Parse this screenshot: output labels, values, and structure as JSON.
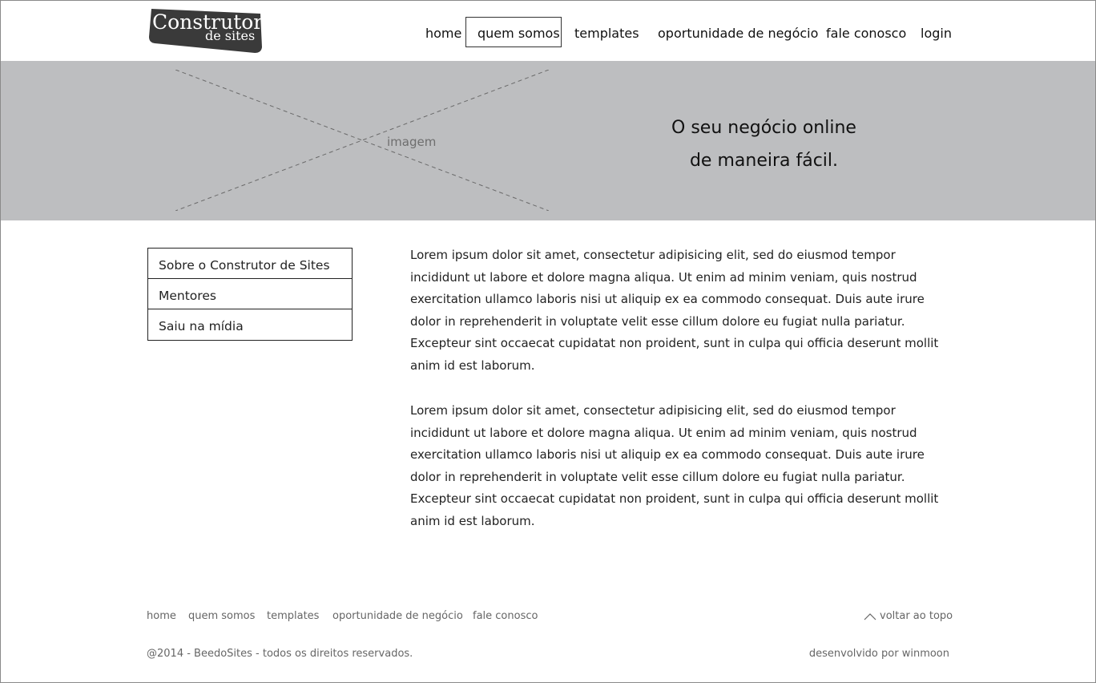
{
  "header": {
    "logo": {
      "line1": "Construtor",
      "line2": "de sites"
    },
    "nav": [
      {
        "label": "home"
      },
      {
        "label": "quem somos",
        "active": true
      },
      {
        "label": "templates"
      },
      {
        "label": "oportunidade de negócio"
      },
      {
        "label": "fale conosco"
      },
      {
        "label": "login"
      }
    ]
  },
  "hero": {
    "image_placeholder": "imagem",
    "tagline_line1": "O seu negócio online",
    "tagline_line2": "de maneira fácil.",
    "background_color": "#bdbec0"
  },
  "sidebar": {
    "items": [
      {
        "label": "Sobre o Construtor de Sites"
      },
      {
        "label": "Mentores"
      },
      {
        "label": "Saiu na mídia"
      }
    ]
  },
  "content": {
    "paragraphs": [
      "Lorem ipsum dolor sit amet, consectetur adipisicing elit, sed do eiusmod tempor incididunt ut labore et dolore magna aliqua. Ut enim ad minim veniam, quis nostrud exercitation ullamco laboris nisi ut aliquip ex ea commodo consequat. Duis aute irure dolor in reprehenderit in voluptate velit esse cillum dolore eu fugiat nulla pariatur. Excepteur sint occaecat cupidatat non proident, sunt in culpa qui officia deserunt mollit anim id est laborum.",
      "Lorem ipsum dolor sit amet, consectetur adipisicing elit, sed do eiusmod tempor incididunt ut labore et dolore magna aliqua. Ut enim ad minim veniam, quis nostrud exercitation ullamco laboris nisi ut aliquip ex ea commodo consequat. Duis aute irure dolor in reprehenderit in voluptate velit esse cillum dolore eu fugiat nulla pariatur. Excepteur sint occaecat cupidatat non proident, sunt in culpa qui officia deserunt mollit anim id est laborum."
    ]
  },
  "footer": {
    "nav": [
      {
        "label": "home"
      },
      {
        "label": "quem somos"
      },
      {
        "label": "templates"
      },
      {
        "label": "oportunidade de negócio"
      },
      {
        "label": "fale conosco"
      }
    ],
    "back_to_top": "voltar ao topo",
    "back_to_top_icon": "chevron-up-icon",
    "copyright": "@2014 - BeedoSites - todos os direitos reservados.",
    "credit": "desenvolvido por winmoon"
  }
}
